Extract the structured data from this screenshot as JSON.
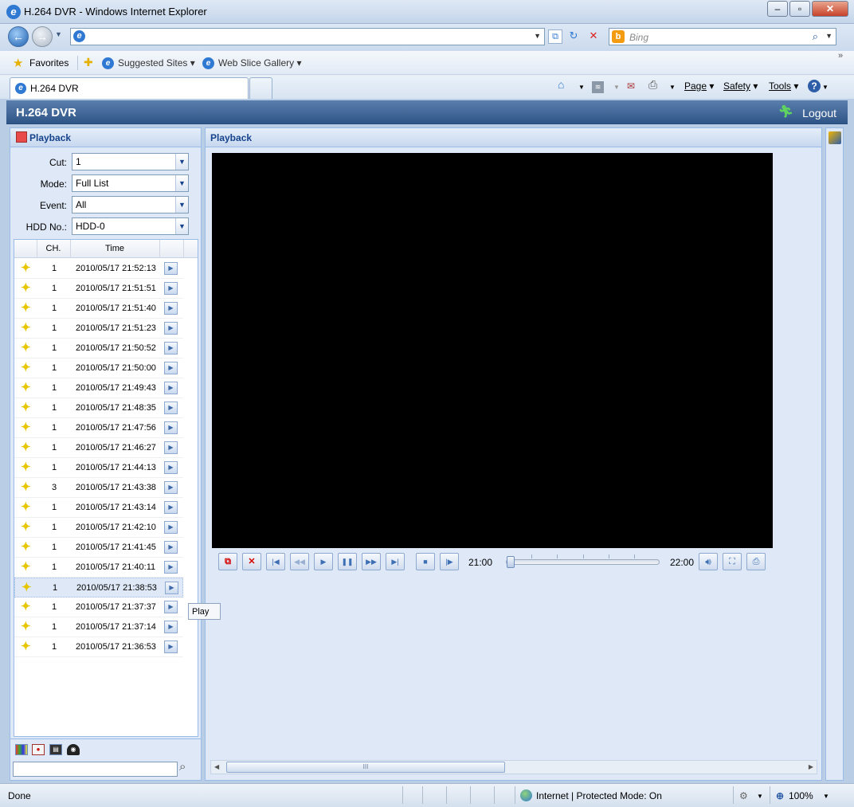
{
  "browser": {
    "title": "H.264 DVR - Windows Internet Explorer",
    "search_placeholder": "Bing",
    "favorites_label": "Favorites",
    "suggested_sites_label": "Suggested Sites",
    "web_slice_label": "Web Slice Gallery",
    "tab_title": "H.264 DVR",
    "commands": {
      "page": "Page",
      "safety": "Safety",
      "tools": "Tools"
    }
  },
  "app": {
    "header_title": "H.264 DVR",
    "logout_label": "Logout",
    "left_panel_title": "Playback",
    "main_panel_title": "Playback"
  },
  "filters": [
    {
      "label": "Cut:",
      "value": "1"
    },
    {
      "label": "Mode:",
      "value": "Full List"
    },
    {
      "label": "Event:",
      "value": "All"
    },
    {
      "label": "HDD No.:",
      "value": "HDD-0"
    }
  ],
  "grid": {
    "columns": [
      "CH.",
      "Time"
    ],
    "rows": [
      {
        "ch": "1",
        "time": "2010/05/17 21:52:13"
      },
      {
        "ch": "1",
        "time": "2010/05/17 21:51:51"
      },
      {
        "ch": "1",
        "time": "2010/05/17 21:51:40"
      },
      {
        "ch": "1",
        "time": "2010/05/17 21:51:23"
      },
      {
        "ch": "1",
        "time": "2010/05/17 21:50:52"
      },
      {
        "ch": "1",
        "time": "2010/05/17 21:50:00"
      },
      {
        "ch": "1",
        "time": "2010/05/17 21:49:43"
      },
      {
        "ch": "1",
        "time": "2010/05/17 21:48:35"
      },
      {
        "ch": "1",
        "time": "2010/05/17 21:47:56"
      },
      {
        "ch": "1",
        "time": "2010/05/17 21:46:27"
      },
      {
        "ch": "1",
        "time": "2010/05/17 21:44:13"
      },
      {
        "ch": "3",
        "time": "2010/05/17 21:43:38"
      },
      {
        "ch": "1",
        "time": "2010/05/17 21:43:14"
      },
      {
        "ch": "1",
        "time": "2010/05/17 21:42:10"
      },
      {
        "ch": "1",
        "time": "2010/05/17 21:41:45"
      },
      {
        "ch": "1",
        "time": "2010/05/17 21:40:11"
      },
      {
        "ch": "1",
        "time": "2010/05/17 21:38:53",
        "selected": true
      },
      {
        "ch": "1",
        "time": "2010/05/17 21:37:37"
      },
      {
        "ch": "1",
        "time": "2010/05/17 21:37:14"
      },
      {
        "ch": "1",
        "time": "2010/05/17 21:36:53"
      }
    ]
  },
  "timeline": {
    "start": "21:00",
    "end": "22:00",
    "position": 0.0
  },
  "tooltip": "Play",
  "status": {
    "left": "Done",
    "zone": "Internet | Protected Mode: On",
    "zoom": "100%"
  },
  "colors": {
    "header": "#2f5587",
    "panel": "#dfe8f6",
    "event_icon": "#e7c600"
  }
}
